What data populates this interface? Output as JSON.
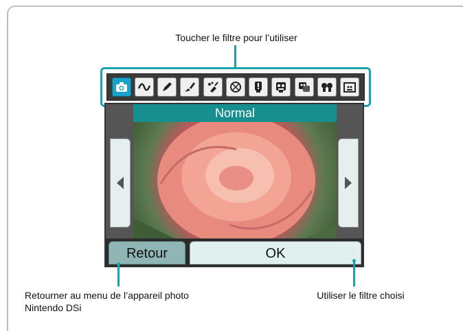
{
  "callouts": {
    "top": "Toucher le filtre pour l’utiliser",
    "bottom_left_line1": "Retourner au menu de l’appareil photo",
    "bottom_left_line2": "Nintendo DSi",
    "bottom_right": "Utiliser le filtre choisi"
  },
  "screen": {
    "title": "Normal",
    "back_button": "Retour",
    "ok_button": "OK"
  },
  "filters": [
    {
      "icon": "camera-icon",
      "selected": true
    },
    {
      "icon": "wave-icon",
      "selected": false
    },
    {
      "icon": "pencil-icon",
      "selected": false
    },
    {
      "icon": "brush-icon",
      "selected": false
    },
    {
      "icon": "sparkle-brush-icon",
      "selected": false
    },
    {
      "icon": "mosaic-icon",
      "selected": false
    },
    {
      "icon": "exclamation-face-icon",
      "selected": false
    },
    {
      "icon": "monster-face-icon",
      "selected": false
    },
    {
      "icon": "double-face-icon",
      "selected": false
    },
    {
      "icon": "twins-icon",
      "selected": false
    },
    {
      "icon": "frame-face-icon",
      "selected": false
    }
  ],
  "colors": {
    "accent": "#16a3a9",
    "title_bar": "#178f8f",
    "selected_filter": "#1aa3c9"
  }
}
